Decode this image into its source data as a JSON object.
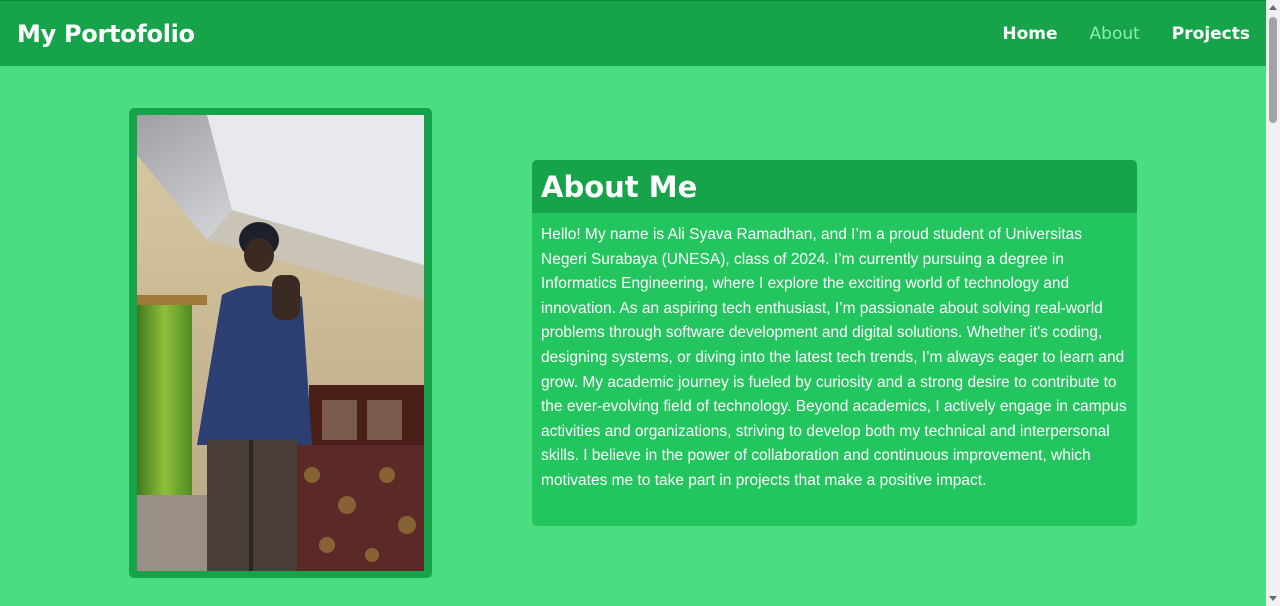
{
  "brand": "My Portofolio",
  "nav": {
    "items": [
      {
        "label": "Home",
        "active": false
      },
      {
        "label": "About",
        "active": true
      },
      {
        "label": "Projects",
        "active": false
      }
    ]
  },
  "about": {
    "title": "About Me",
    "paragraph": "Hello! My name is Ali Syava Ramadhan, and I’m a proud student of Universitas Negeri Surabaya (UNESA), class of 2024. I’m currently pursuing a degree in Informatics Engineering, where I explore the exciting world of technology and innovation. As an aspiring tech enthusiast, I’m passionate about solving real-world problems through software development and digital solutions. Whether it's coding, designing systems, or diving into the latest tech trends, I’m always eager to learn and grow. My academic journey is fueled by curiosity and a strong desire to contribute to the ever-evolving field of technology. Beyond academics, I actively engage in campus activities and organizations, striving to develop both my technical and interpersonal skills. I believe in the power of collaboration and continuous improvement, which motivates me to take part in projects that make a positive impact."
  },
  "colors": {
    "page_background": "#4ade80",
    "navbar": "#16a34a",
    "card": "#22c55e",
    "active_link": "#86efac"
  }
}
